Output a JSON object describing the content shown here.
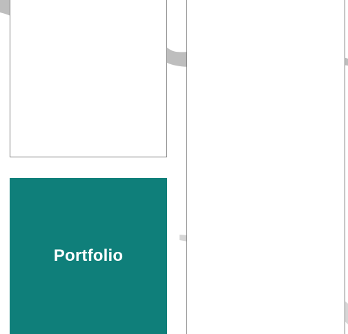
{
  "tiles": {
    "portfolio": {
      "label": "Portfolio"
    }
  },
  "colors": {
    "tile_teal": "#0f7f7a",
    "panel_border": "#7a7a7a",
    "background_swirl": "#b3b3b3",
    "page_background": "#ffffff"
  },
  "icons": {
    "background": "gray-brush-swirl-decoration"
  }
}
